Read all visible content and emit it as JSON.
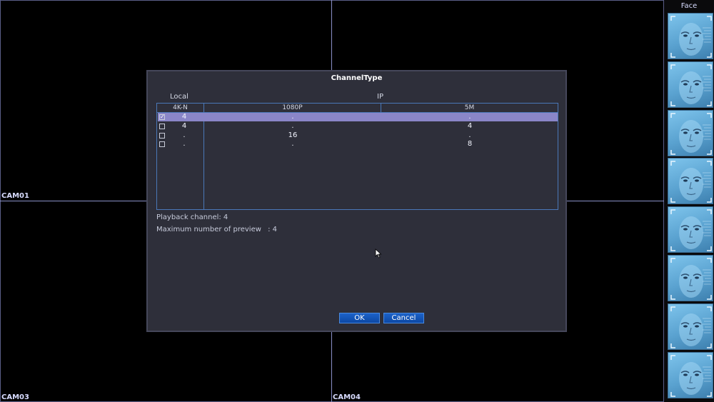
{
  "cameras": [
    "CAM01",
    "CAM03",
    "CAM04"
  ],
  "sidebar": {
    "title": "Face",
    "thumb_count": 8
  },
  "dialog": {
    "title": "ChannelType",
    "local_header": "Local",
    "ip_header": "IP",
    "columns": [
      "4K-N",
      "1080P",
      "5M"
    ],
    "rows": [
      {
        "checked": true,
        "local": "4",
        "p1080": ".",
        "m5": "."
      },
      {
        "checked": false,
        "local": "4",
        "p1080": ".",
        "m5": "4"
      },
      {
        "checked": false,
        "local": ".",
        "p1080": "16",
        "m5": "."
      },
      {
        "checked": false,
        "local": ".",
        "p1080": ".",
        "m5": "8"
      }
    ],
    "selected_row": 0,
    "playback": "Playback channel: 4",
    "preview_label": "Maximum number of preview",
    "preview_value": ": 4",
    "ok_label": "OK",
    "cancel_label": "Cancel"
  },
  "colors": {
    "accent": "#1c62c8",
    "selection": "#8a86c8",
    "grid_line": "#8a8fc8",
    "face_bg": "#5aa2d0"
  }
}
